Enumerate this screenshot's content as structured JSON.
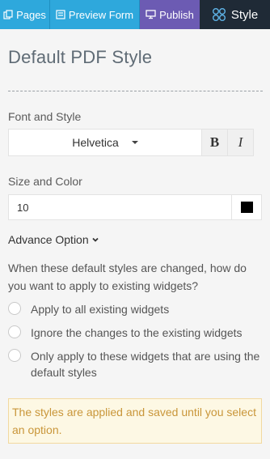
{
  "nav": {
    "tabs": [
      {
        "label": "Pages",
        "icon": "pages-icon"
      },
      {
        "label": "Preview Form",
        "icon": "preview-form-icon"
      },
      {
        "label": "Publish",
        "icon": "publish-monitor-icon"
      },
      {
        "label": "Style",
        "icon": "style-icon"
      }
    ],
    "colors": {
      "pages": "#2ea8dc",
      "preview": "#2ea8dc",
      "publish": "#6c5bb3",
      "style": "#1f2a36"
    }
  },
  "panel": {
    "title": "Default PDF Style",
    "font_label": "Font and Style",
    "font_value": "Helvetica",
    "bold_label": "B",
    "italic_label": "I",
    "size_label": "Size and Color",
    "size_value": "10",
    "color_value": "#000000",
    "advance_label": "Advance Option",
    "question": "When these default styles are changed, how do you want to apply to existing widgets?",
    "options": [
      "Apply to all existing widgets",
      "Ignore the changes to the existing widgets",
      "Only apply to these widgets that are using the default styles"
    ],
    "notice": "The styles are applied and saved until you select an option."
  }
}
